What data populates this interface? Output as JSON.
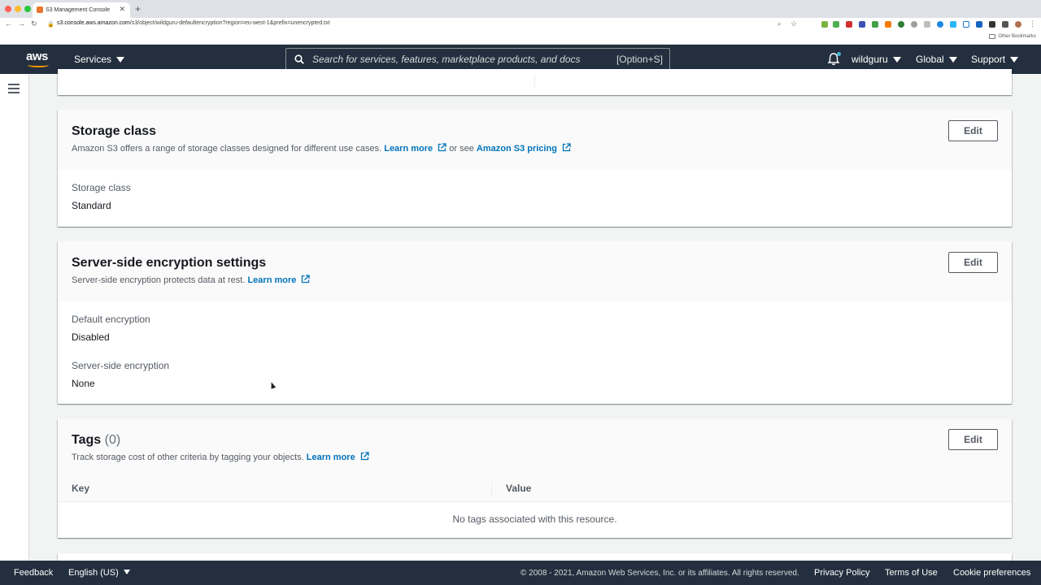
{
  "browser": {
    "tab_title": "S3 Management Console",
    "url_host": "s3.console.aws.amazon.com",
    "url_path": "/s3/object/wildguru-defaultencryption?region=eu-west-1&prefix=unencrypted.txt",
    "bookmarks_label": "Other Bookmarks"
  },
  "header": {
    "logo_text": "aws",
    "services_label": "Services",
    "search_placeholder": "Search for services, features, marketplace products, and docs",
    "search_shortcut": "[Option+S]",
    "account_label": "wildguru",
    "region_label": "Global",
    "support_label": "Support"
  },
  "storage_class": {
    "title": "Storage class",
    "desc_prefix": "Amazon S3 offers a range of storage classes designed for different use cases.",
    "learn_more": "Learn more",
    "or_see": "or see",
    "pricing_link": "Amazon S3 pricing",
    "edit_label": "Edit",
    "field_label": "Storage class",
    "field_value": "Standard"
  },
  "encryption": {
    "title": "Server-side encryption settings",
    "desc_prefix": "Server-side encryption protects data at rest.",
    "learn_more": "Learn more",
    "edit_label": "Edit",
    "default_label": "Default encryption",
    "default_value": "Disabled",
    "sse_label": "Server-side encryption",
    "sse_value": "None"
  },
  "tags": {
    "title": "Tags",
    "count": "(0)",
    "desc_prefix": "Track storage cost of other criteria by tagging your objects.",
    "learn_more": "Learn more",
    "edit_label": "Edit",
    "columns": [
      "Key",
      "Value"
    ],
    "empty_message": "No tags associated with this resource."
  },
  "footer": {
    "feedback": "Feedback",
    "language": "English (US)",
    "copyright": "© 2008 - 2021, Amazon Web Services, Inc. or its affiliates. All rights reserved.",
    "privacy": "Privacy Policy",
    "terms": "Terms of Use",
    "cookies": "Cookie preferences"
  },
  "colors": {
    "header_bg": "#232f3e",
    "link": "#0073bb",
    "accent_orange": "#ff9900"
  }
}
